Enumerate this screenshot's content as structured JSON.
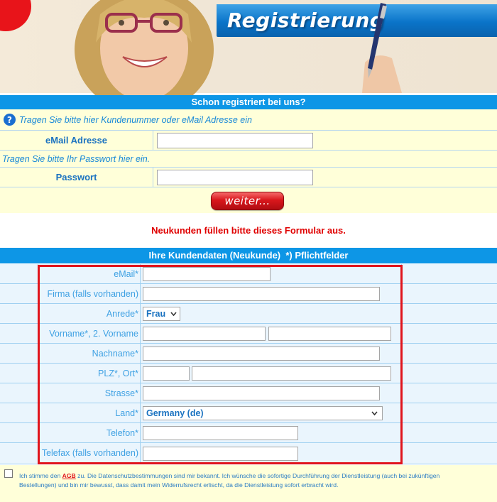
{
  "header": {
    "title": "Registrierung"
  },
  "login": {
    "title": "Schon registriert bei uns?",
    "hint_customer": "Tragen Sie bitte hier Kundenummer oder eMail Adresse ein",
    "email_label": "eMail Adresse",
    "email_value": "",
    "hint_password": "Tragen Sie bitte Ihr Passwort hier ein.",
    "password_label": "Passwort",
    "password_value": "",
    "submit_label": "weiter..."
  },
  "new_customer_note": "Neukunden füllen bitte dieses Formular aus.",
  "form": {
    "title": "Ihre Kundendaten (Neukunde)  *) Pflichtfelder",
    "email_label": "eMail*",
    "company_label": "Firma (falls vorhanden)",
    "salutation_label": "Anrede*",
    "salutation_value": "Frau",
    "firstname_label": "Vorname*, 2. Vorname",
    "lastname_label": "Nachname*",
    "zip_city_label": "PLZ*, Ort*",
    "street_label": "Strasse*",
    "country_label": "Land*",
    "country_value": "Germany (de)",
    "phone_label": "Telefon*",
    "fax_label": "Telefax (falls vorhanden)"
  },
  "agreement": {
    "text_before": "Ich stimme den ",
    "link": "AGB",
    "text_after": " zu. Die Datenschutzbestimmungen sind mir bekannt. Ich wünsche die sofortige Durchführung der Dienstleistung (auch bei zukünftigen Bestellungen) und bin mir bewusst, dass damit mein Widerrufsrecht erlischt, da die Dienstleistung sofort erbracht wird."
  },
  "colors": {
    "accent_blue": "#0d96e6",
    "field_yellow": "#ffffd9",
    "highlight_red": "#e0141c"
  },
  "icons": {
    "help": "question-circle",
    "dropdown": "chevron-down"
  }
}
